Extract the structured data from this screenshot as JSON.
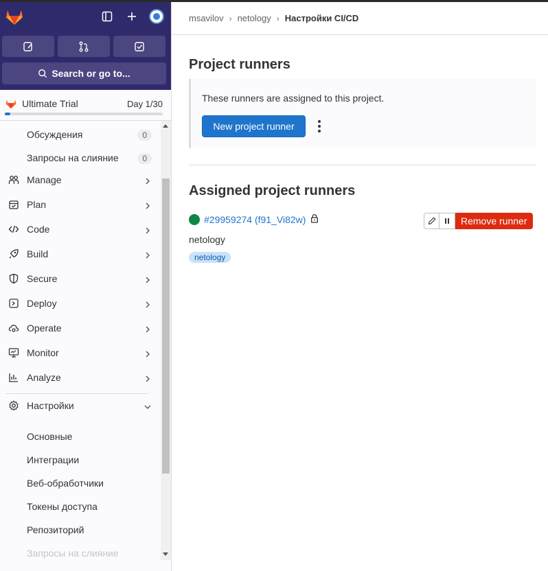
{
  "sidebar": {
    "search_label": "Search or go to...",
    "trial": {
      "label": "Ultimate Trial",
      "day": "Day 1/30",
      "progress": 0.033
    },
    "sub_items_top": [
      {
        "label": "Обсуждения",
        "count": "0"
      },
      {
        "label": "Запросы на слияние",
        "count": "0"
      }
    ],
    "nav": [
      {
        "label": "Manage"
      },
      {
        "label": "Plan"
      },
      {
        "label": "Code"
      },
      {
        "label": "Build"
      },
      {
        "label": "Secure"
      },
      {
        "label": "Deploy"
      },
      {
        "label": "Operate"
      },
      {
        "label": "Monitor"
      },
      {
        "label": "Analyze"
      }
    ],
    "settings": {
      "label": "Настройки",
      "items": [
        {
          "label": "Основные"
        },
        {
          "label": "Интеграции"
        },
        {
          "label": "Веб-обработчики"
        },
        {
          "label": "Токены доступа"
        },
        {
          "label": "Репозиторий"
        },
        {
          "label": "Запросы на слияние"
        }
      ]
    }
  },
  "breadcrumb": {
    "items": [
      "msavilov",
      "netology"
    ],
    "current": "Настройки CI/CD"
  },
  "project_runners": {
    "title": "Project runners",
    "info": "These runners are assigned to this project.",
    "new_button": "New project runner"
  },
  "assigned": {
    "title": "Assigned project runners",
    "runner": {
      "id": "#29959274 (f91_Vi82w)",
      "description": "netology",
      "tag": "netology",
      "status_color": "#108548",
      "remove_label": "Remove runner"
    }
  },
  "colors": {
    "sidebar_top": "#2f2a6b",
    "primary": "#1f75cb",
    "danger": "#dd2b0e",
    "online": "#108548"
  }
}
